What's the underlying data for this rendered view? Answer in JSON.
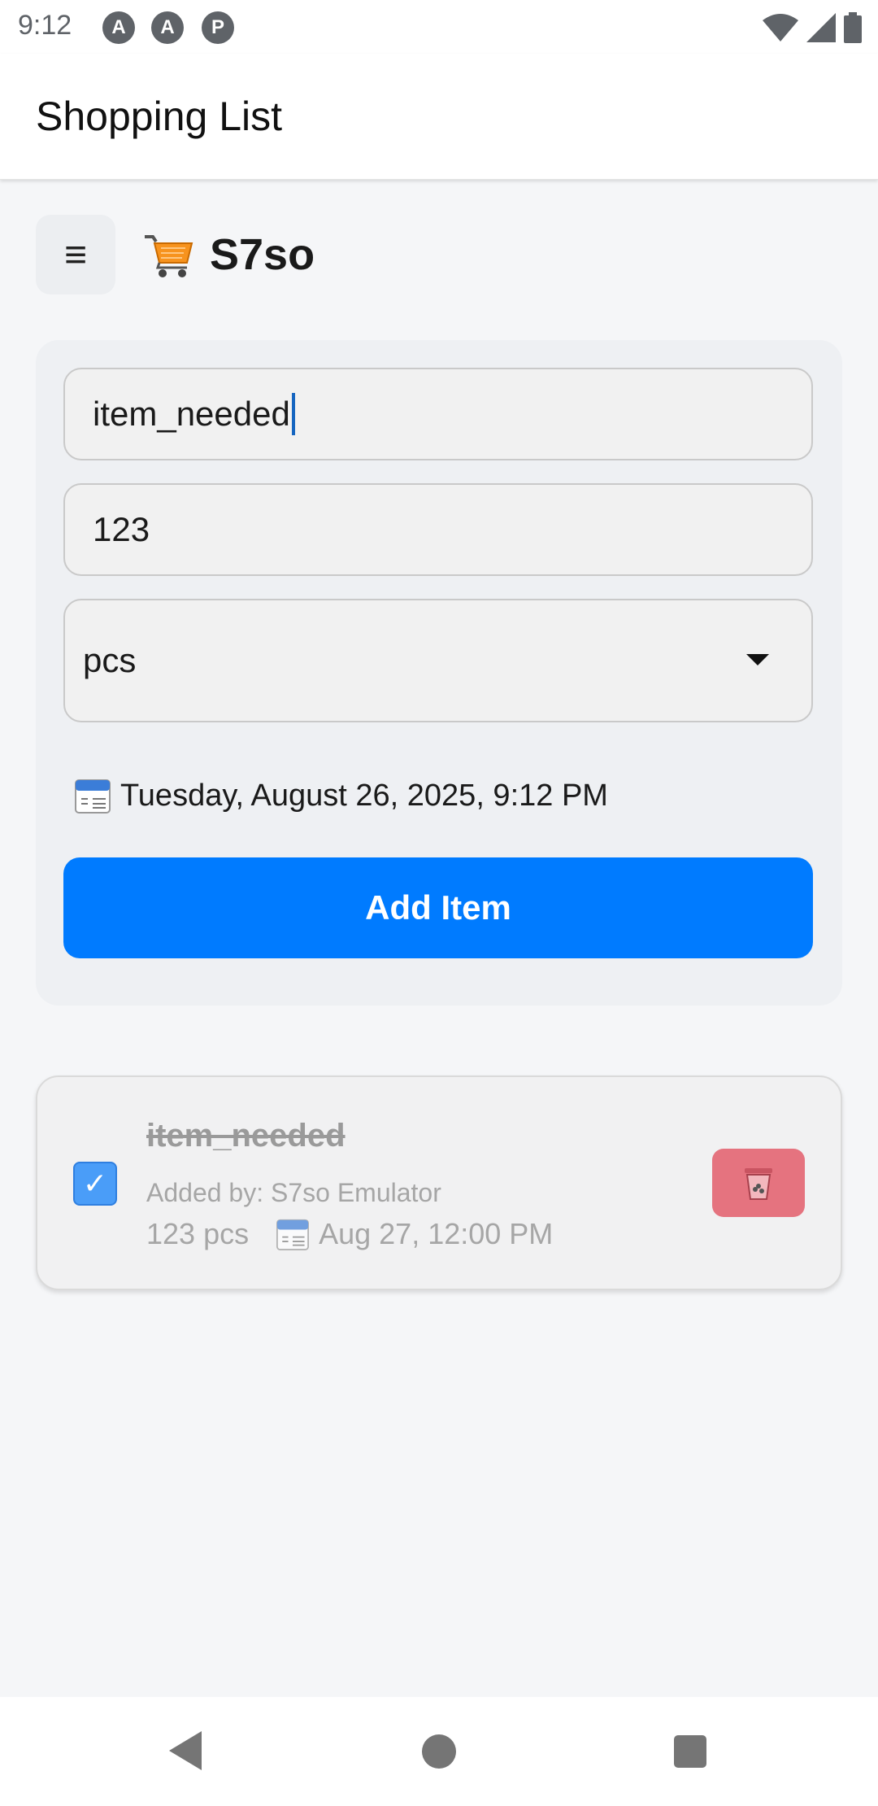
{
  "status_bar": {
    "time": "9:12",
    "notification_icons": [
      "A",
      "A",
      "P"
    ],
    "right_icons": [
      "wifi-icon",
      "signal-icon",
      "battery-icon"
    ]
  },
  "app_bar": {
    "title": "Shopping List"
  },
  "header": {
    "menu_icon": "≡",
    "cart_icon": "cart-icon",
    "user_name": "S7so"
  },
  "form": {
    "item_name_value": "item_needed",
    "quantity_value": "123",
    "unit_selected": "pcs",
    "date_text": "Tuesday, August 26, 2025, 9:12 PM",
    "add_button_label": "Add Item"
  },
  "items": [
    {
      "name": "item_needed",
      "checked": true,
      "check_mark": "✓",
      "added_by": "Added by: S7so Emulator",
      "quantity_unit": "123 pcs",
      "date": "Aug 27, 12:00 PM"
    }
  ],
  "colors": {
    "accent": "#007bff",
    "delete": "#e5737f",
    "checkbox": "#4a9df8"
  }
}
